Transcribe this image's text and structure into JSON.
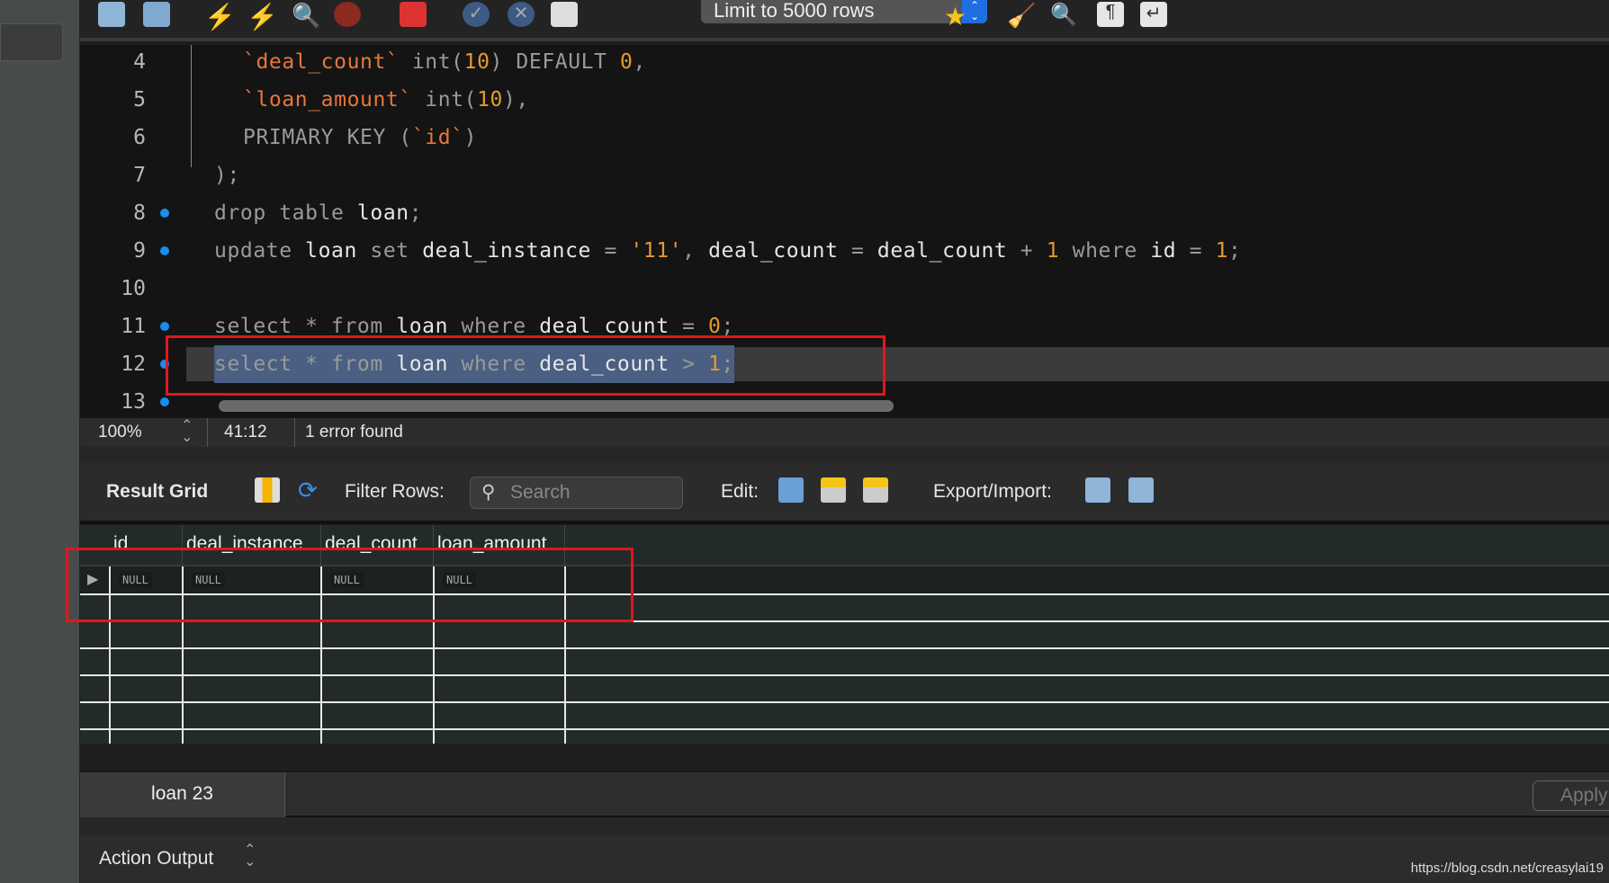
{
  "toolbar": {
    "limit_select": "Limit to 5000 rows",
    "icons": [
      "open-file-icon",
      "save-icon",
      "execute-icon",
      "execute-current-icon",
      "explain-icon",
      "stop-icon",
      "toggle-error-icon",
      "commit-icon",
      "rollback-icon",
      "autocommit-icon",
      "add-snippet-icon",
      "beautify-icon",
      "find-icon",
      "invisibles-icon",
      "wrap-icon"
    ]
  },
  "editor": {
    "lines": [
      {
        "num": "4",
        "marker": false,
        "indent": true,
        "tokens": [
          {
            "t": "`deal_count`",
            "c": "b"
          },
          {
            "t": " int(",
            "c": "p"
          },
          {
            "t": "10",
            "c": "n"
          },
          {
            "t": ") DEFAULT ",
            "c": "p"
          },
          {
            "t": "0",
            "c": "n"
          },
          {
            "t": ",",
            "c": "p"
          }
        ]
      },
      {
        "num": "5",
        "marker": false,
        "indent": true,
        "tokens": [
          {
            "t": "`loan_amount`",
            "c": "b"
          },
          {
            "t": " int(",
            "c": "p"
          },
          {
            "t": "10",
            "c": "n"
          },
          {
            "t": "),",
            "c": "p"
          }
        ]
      },
      {
        "num": "6",
        "marker": false,
        "indent": true,
        "tokens": [
          {
            "t": "PRIMARY KEY (",
            "c": "p"
          },
          {
            "t": "`id`",
            "c": "b"
          },
          {
            "t": ")",
            "c": "p"
          }
        ]
      },
      {
        "num": "7",
        "marker": false,
        "indent": false,
        "tokens": [
          {
            "t": ");",
            "c": "p"
          }
        ]
      },
      {
        "num": "8",
        "marker": true,
        "indent": false,
        "tokens": [
          {
            "t": "drop table ",
            "c": "k"
          },
          {
            "t": "loan",
            "c": "i"
          },
          {
            "t": ";",
            "c": "p"
          }
        ]
      },
      {
        "num": "9",
        "marker": true,
        "indent": false,
        "tokens": [
          {
            "t": "update ",
            "c": "k"
          },
          {
            "t": "loan",
            "c": "i"
          },
          {
            "t": " set ",
            "c": "k"
          },
          {
            "t": "deal_instance",
            "c": "i"
          },
          {
            "t": " = ",
            "c": "p"
          },
          {
            "t": "'11'",
            "c": "n"
          },
          {
            "t": ", ",
            "c": "p"
          },
          {
            "t": "deal_count",
            "c": "i"
          },
          {
            "t": " = ",
            "c": "p"
          },
          {
            "t": "deal_count",
            "c": "i"
          },
          {
            "t": " + ",
            "c": "p"
          },
          {
            "t": "1",
            "c": "n"
          },
          {
            "t": " where ",
            "c": "k"
          },
          {
            "t": "id",
            "c": "i"
          },
          {
            "t": " = ",
            "c": "p"
          },
          {
            "t": "1",
            "c": "n"
          },
          {
            "t": ";",
            "c": "p"
          }
        ]
      },
      {
        "num": "10",
        "marker": false,
        "indent": false,
        "tokens": []
      },
      {
        "num": "11",
        "marker": true,
        "indent": false,
        "tokens": [
          {
            "t": "select * from ",
            "c": "k"
          },
          {
            "t": "loan",
            "c": "i"
          },
          {
            "t": " where ",
            "c": "k"
          },
          {
            "t": "deal_count",
            "c": "i"
          },
          {
            "t": " = ",
            "c": "p"
          },
          {
            "t": "0",
            "c": "n"
          },
          {
            "t": ";",
            "c": "p"
          }
        ]
      },
      {
        "num": "12",
        "marker": true,
        "indent": false,
        "current": true,
        "tokens": [
          {
            "t": "select * from ",
            "c": "k"
          },
          {
            "t": "loan",
            "c": "i"
          },
          {
            "t": " where ",
            "c": "k"
          },
          {
            "t": "deal_count",
            "c": "i"
          },
          {
            "t": " > ",
            "c": "p"
          },
          {
            "t": "1",
            "c": "n"
          },
          {
            "t": ";",
            "c": "p"
          }
        ]
      },
      {
        "num": "13",
        "marker": true,
        "indent": false,
        "tokens": []
      }
    ]
  },
  "status": {
    "zoom": "100%",
    "cursor": "41:12",
    "message": "1 error found"
  },
  "result": {
    "title": "Result Grid",
    "filter_label": "Filter Rows:",
    "search_placeholder": "Search",
    "edit_label": "Edit:",
    "export_label": "Export/Import:",
    "columns": [
      "id",
      "deal_instance",
      "deal_count",
      "loan_amount"
    ],
    "rows": [
      [
        "NULL",
        "NULL",
        "NULL",
        "NULL"
      ]
    ]
  },
  "tabs": [
    {
      "label": "loan 23"
    }
  ],
  "apply_label": "Apply",
  "action_output": "Action Output",
  "watermark": "https://blog.csdn.net/creasylai19",
  "colors": {
    "accent": "#1f6fe0",
    "annotation": "#e3161b"
  }
}
